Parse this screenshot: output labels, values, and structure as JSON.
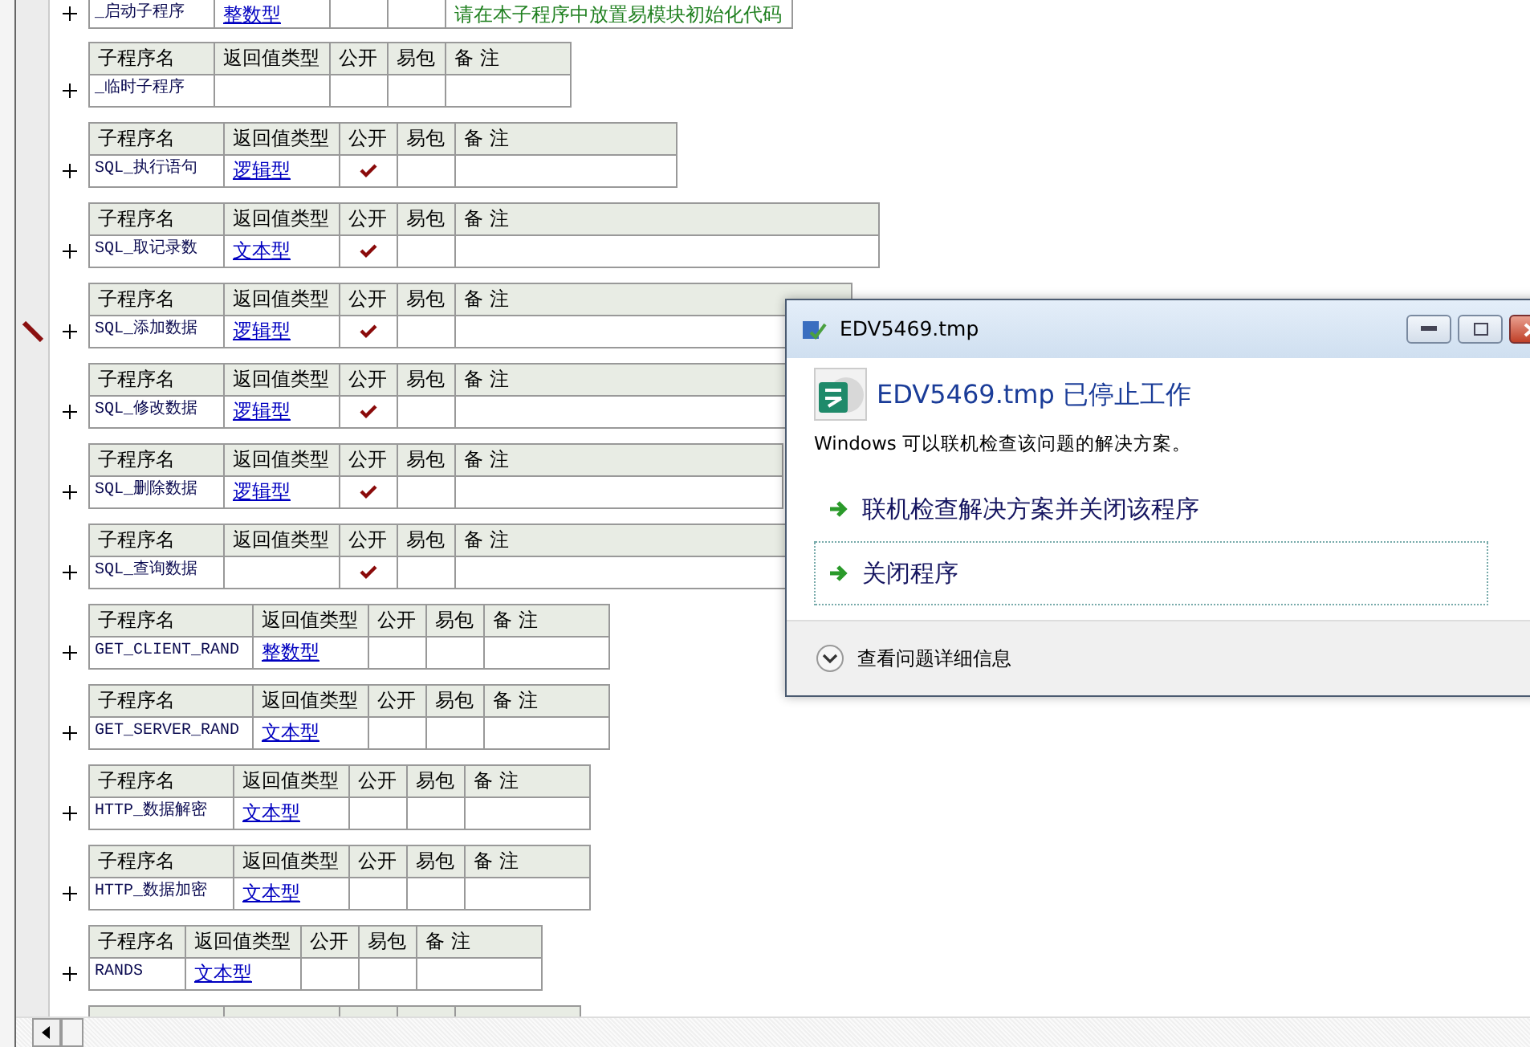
{
  "procedures": [
    {
      "kind": "row_only",
      "editing": false,
      "name": "_启动子程序",
      "return_type": "整数型",
      "public": false,
      "remark": "请在本子程序中放置易模块初始化代码"
    },
    {
      "kind": "full",
      "editing": false,
      "columns": [
        "子程序名",
        "返回值类型",
        "公开",
        "易包",
        "备 注"
      ],
      "name": "_临时子程序",
      "public": false
    },
    {
      "kind": "full",
      "editing": false,
      "columns": [
        "子程序名",
        "返回值类型",
        "公开",
        "易包",
        "备 注"
      ],
      "name": "SQL_执行语句",
      "return_type": "逻辑型",
      "public": true
    },
    {
      "kind": "full",
      "editing": false,
      "columns": [
        "子程序名",
        "返回值类型",
        "公开",
        "易包",
        "备 注"
      ],
      "name": "SQL_取记录数",
      "return_type": "文本型",
      "public": true
    },
    {
      "kind": "full",
      "editing": true,
      "columns": [
        "子程序名",
        "返回值类型",
        "公开",
        "易包",
        "备 注"
      ],
      "name": "SQL_添加数据",
      "return_type": "逻辑型",
      "public": true
    },
    {
      "kind": "full",
      "editing": false,
      "columns": [
        "子程序名",
        "返回值类型",
        "公开",
        "易包",
        "备 注"
      ],
      "name": "SQL_修改数据",
      "return_type": "逻辑型",
      "public": true
    },
    {
      "kind": "full",
      "editing": false,
      "columns": [
        "子程序名",
        "返回值类型",
        "公开",
        "易包",
        "备 注"
      ],
      "name": "SQL_删除数据",
      "return_type": "逻辑型",
      "public": true
    },
    {
      "kind": "full",
      "editing": false,
      "columns": [
        "子程序名",
        "返回值类型",
        "公开",
        "易包",
        "备 注"
      ],
      "name": "SQL_查询数据",
      "public": true
    },
    {
      "kind": "full",
      "editing": false,
      "columns": [
        "子程序名",
        "返回值类型",
        "公开",
        "易包",
        "备 注"
      ],
      "name": "GET_CLIENT_RAND",
      "return_type": "整数型",
      "public": false
    },
    {
      "kind": "full",
      "editing": false,
      "columns": [
        "子程序名",
        "返回值类型",
        "公开",
        "易包",
        "备 注"
      ],
      "name": "GET_SERVER_RAND",
      "return_type": "文本型",
      "public": false
    },
    {
      "kind": "full",
      "editing": false,
      "columns": [
        "子程序名",
        "返回值类型",
        "公开",
        "易包",
        "备 注"
      ],
      "name": "HTTP_数据解密",
      "return_type": "文本型",
      "public": false
    },
    {
      "kind": "full",
      "editing": false,
      "columns": [
        "子程序名",
        "返回值类型",
        "公开",
        "易包",
        "备 注"
      ],
      "name": "HTTP_数据加密",
      "return_type": "文本型",
      "public": false
    },
    {
      "kind": "full",
      "editing": false,
      "columns": [
        "子程序名",
        "返回值类型",
        "公开",
        "易包",
        "备 注"
      ],
      "name": "RANDS",
      "return_type": "文本型",
      "public": false
    },
    {
      "kind": "header_only"
    }
  ],
  "dialog": {
    "title": "EDV5469.tmp",
    "heading": "EDV5469.tmp 已停止工作",
    "message": "Windows 可以联机检查该问题的解决方案。",
    "options": [
      {
        "label": "联机检查解决方案并关闭该程序",
        "focused": false
      },
      {
        "label": "关闭程序",
        "focused": true
      }
    ],
    "details": "查看问题详细信息"
  }
}
